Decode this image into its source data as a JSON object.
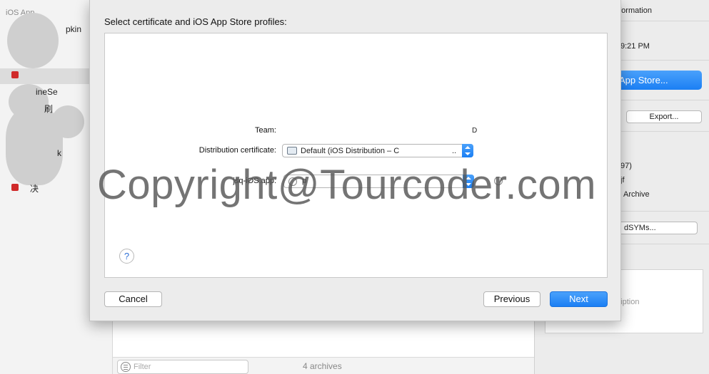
{
  "sidebar": {
    "app_title": "iOS App",
    "items": [
      {
        "label": "pkin"
      },
      {
        "label": "ineSe"
      },
      {
        "label": "刷"
      },
      {
        "label": "k"
      },
      {
        "label": "决"
      }
    ]
  },
  "archives": {
    "filter_placeholder": "Filter",
    "count_label": "4 archives"
  },
  "info_panel": {
    "header": "nformation",
    "date": "9:21 PM",
    "appstore_button": "App Store...",
    "export_button": "Export...",
    "version_text": "97)",
    "bundle_text": "jf",
    "archive_text": "Archive",
    "dsyms_button": "dSYMs...",
    "description_placeholder": "cription"
  },
  "dialog": {
    "title": "Select certificate and iOS App Store profiles:",
    "team_label": "Team:",
    "team_value_tail": "D",
    "dist_cert_label": "Distribution certificate:",
    "dist_cert_value": "Default (iOS Distribution – C",
    "dist_cert_ellipsis": "..",
    "app_label": "jsq-iOS.app:",
    "app_profile_value": "p",
    "help_label": "?",
    "cancel_button": "Cancel",
    "previous_button": "Previous",
    "next_button": "Next"
  },
  "watermark": "Copyright@Tourcoder.com",
  "colors": {
    "accent": "#1b7ff4",
    "sheet_bg": "#ececec",
    "panel_bg": "#ffffff"
  }
}
